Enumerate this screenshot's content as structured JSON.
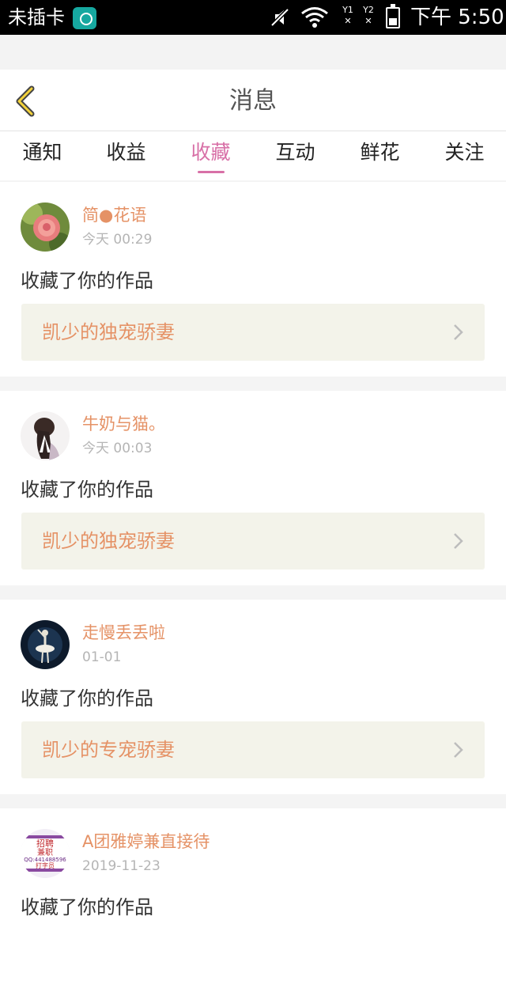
{
  "status_bar": {
    "carrier": "未插卡",
    "sim1": "Y1",
    "sim2": "Y2",
    "time": "下午 5:50"
  },
  "header": {
    "title": "消息"
  },
  "tabs": [
    {
      "label": "通知",
      "active": false
    },
    {
      "label": "收益",
      "active": false
    },
    {
      "label": "收藏",
      "active": true
    },
    {
      "label": "互动",
      "active": false
    },
    {
      "label": "鲜花",
      "active": false
    },
    {
      "label": "关注",
      "active": false
    }
  ],
  "items": [
    {
      "user": "简●花语",
      "time": "今天 00:29",
      "action": "收藏了你的作品",
      "work": "凯少的独宠骄妻",
      "avatar": "rose-avatar"
    },
    {
      "user": "牛奶与猫。",
      "time": "今天 00:03",
      "action": "收藏了你的作品",
      "work": "凯少的独宠骄妻",
      "avatar": "girl-avatar"
    },
    {
      "user": "走慢丢丢啦",
      "time": "01-01",
      "action": "收藏了你的作品",
      "work": "凯少的专宠骄妻",
      "avatar": "ballerina-avatar"
    },
    {
      "user": "A团雅婷兼直接待",
      "time": "2019-11-23",
      "action": "收藏了你的作品",
      "work": "",
      "avatar": "recruit-avatar",
      "avatar_text": [
        "招聘",
        "兼职",
        "QQ:441488596",
        "打字员"
      ]
    }
  ],
  "colors": {
    "accent": "#d870a7",
    "name": "#e59266",
    "card_bg": "#f3f3ea"
  }
}
